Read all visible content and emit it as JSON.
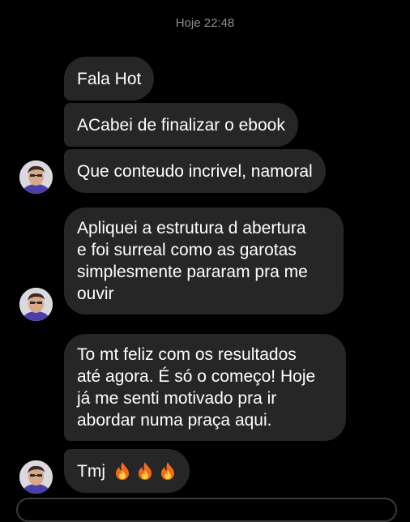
{
  "conversation": {
    "timestamp": "Hoje 22:48",
    "messages": [
      {
        "text": "Fala Hot"
      },
      {
        "text": "ACabei de finalizar o ebook"
      },
      {
        "text": "Que conteudo incrivel, namoral"
      },
      {
        "lines": [
          "Apliquei a estrutura d abertura",
          "e foi surreal como as garotas",
          "simplesmente pararam pra me",
          "ouvir"
        ]
      },
      {
        "lines": [
          "To mt feliz com os resultados",
          "até agora. É só o começo! Hoje",
          "já me senti motivado pra ir",
          "abordar numa praça aqui."
        ]
      },
      {
        "text": "Tmj",
        "emoji": [
          "fire-icon",
          "fire-icon",
          "fire-icon"
        ]
      }
    ]
  },
  "colors": {
    "background": "#000000",
    "bubble": "#262626",
    "text": "#ffffff",
    "timestamp": "#8e8e8e",
    "fire_outer": "#f26b1d",
    "fire_inner": "#ffd23f"
  }
}
